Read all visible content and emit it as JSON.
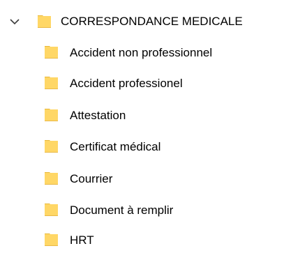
{
  "tree": {
    "root": {
      "label": "CORRESPONDANCE MEDICALE",
      "expanded": true,
      "expander_icon": "chevron-down-icon",
      "icon": "folder-icon"
    },
    "children": [
      {
        "label": "Accident non professionnel",
        "icon": "folder-icon"
      },
      {
        "label": "Accident professionel",
        "icon": "folder-icon"
      },
      {
        "label": "Attestation",
        "icon": "folder-icon"
      },
      {
        "label": "Certificat médical",
        "icon": "folder-icon"
      },
      {
        "label": "Courrier",
        "icon": "folder-icon"
      },
      {
        "label": "Document à remplir",
        "icon": "folder-icon"
      },
      {
        "label": "HRT",
        "icon": "folder-icon"
      }
    ]
  },
  "colors": {
    "folder_front": "#FFD766",
    "folder_back": "#E8B83A",
    "chevron": "#3C3C3C",
    "text": "#000000",
    "background": "#FFFFFF"
  }
}
